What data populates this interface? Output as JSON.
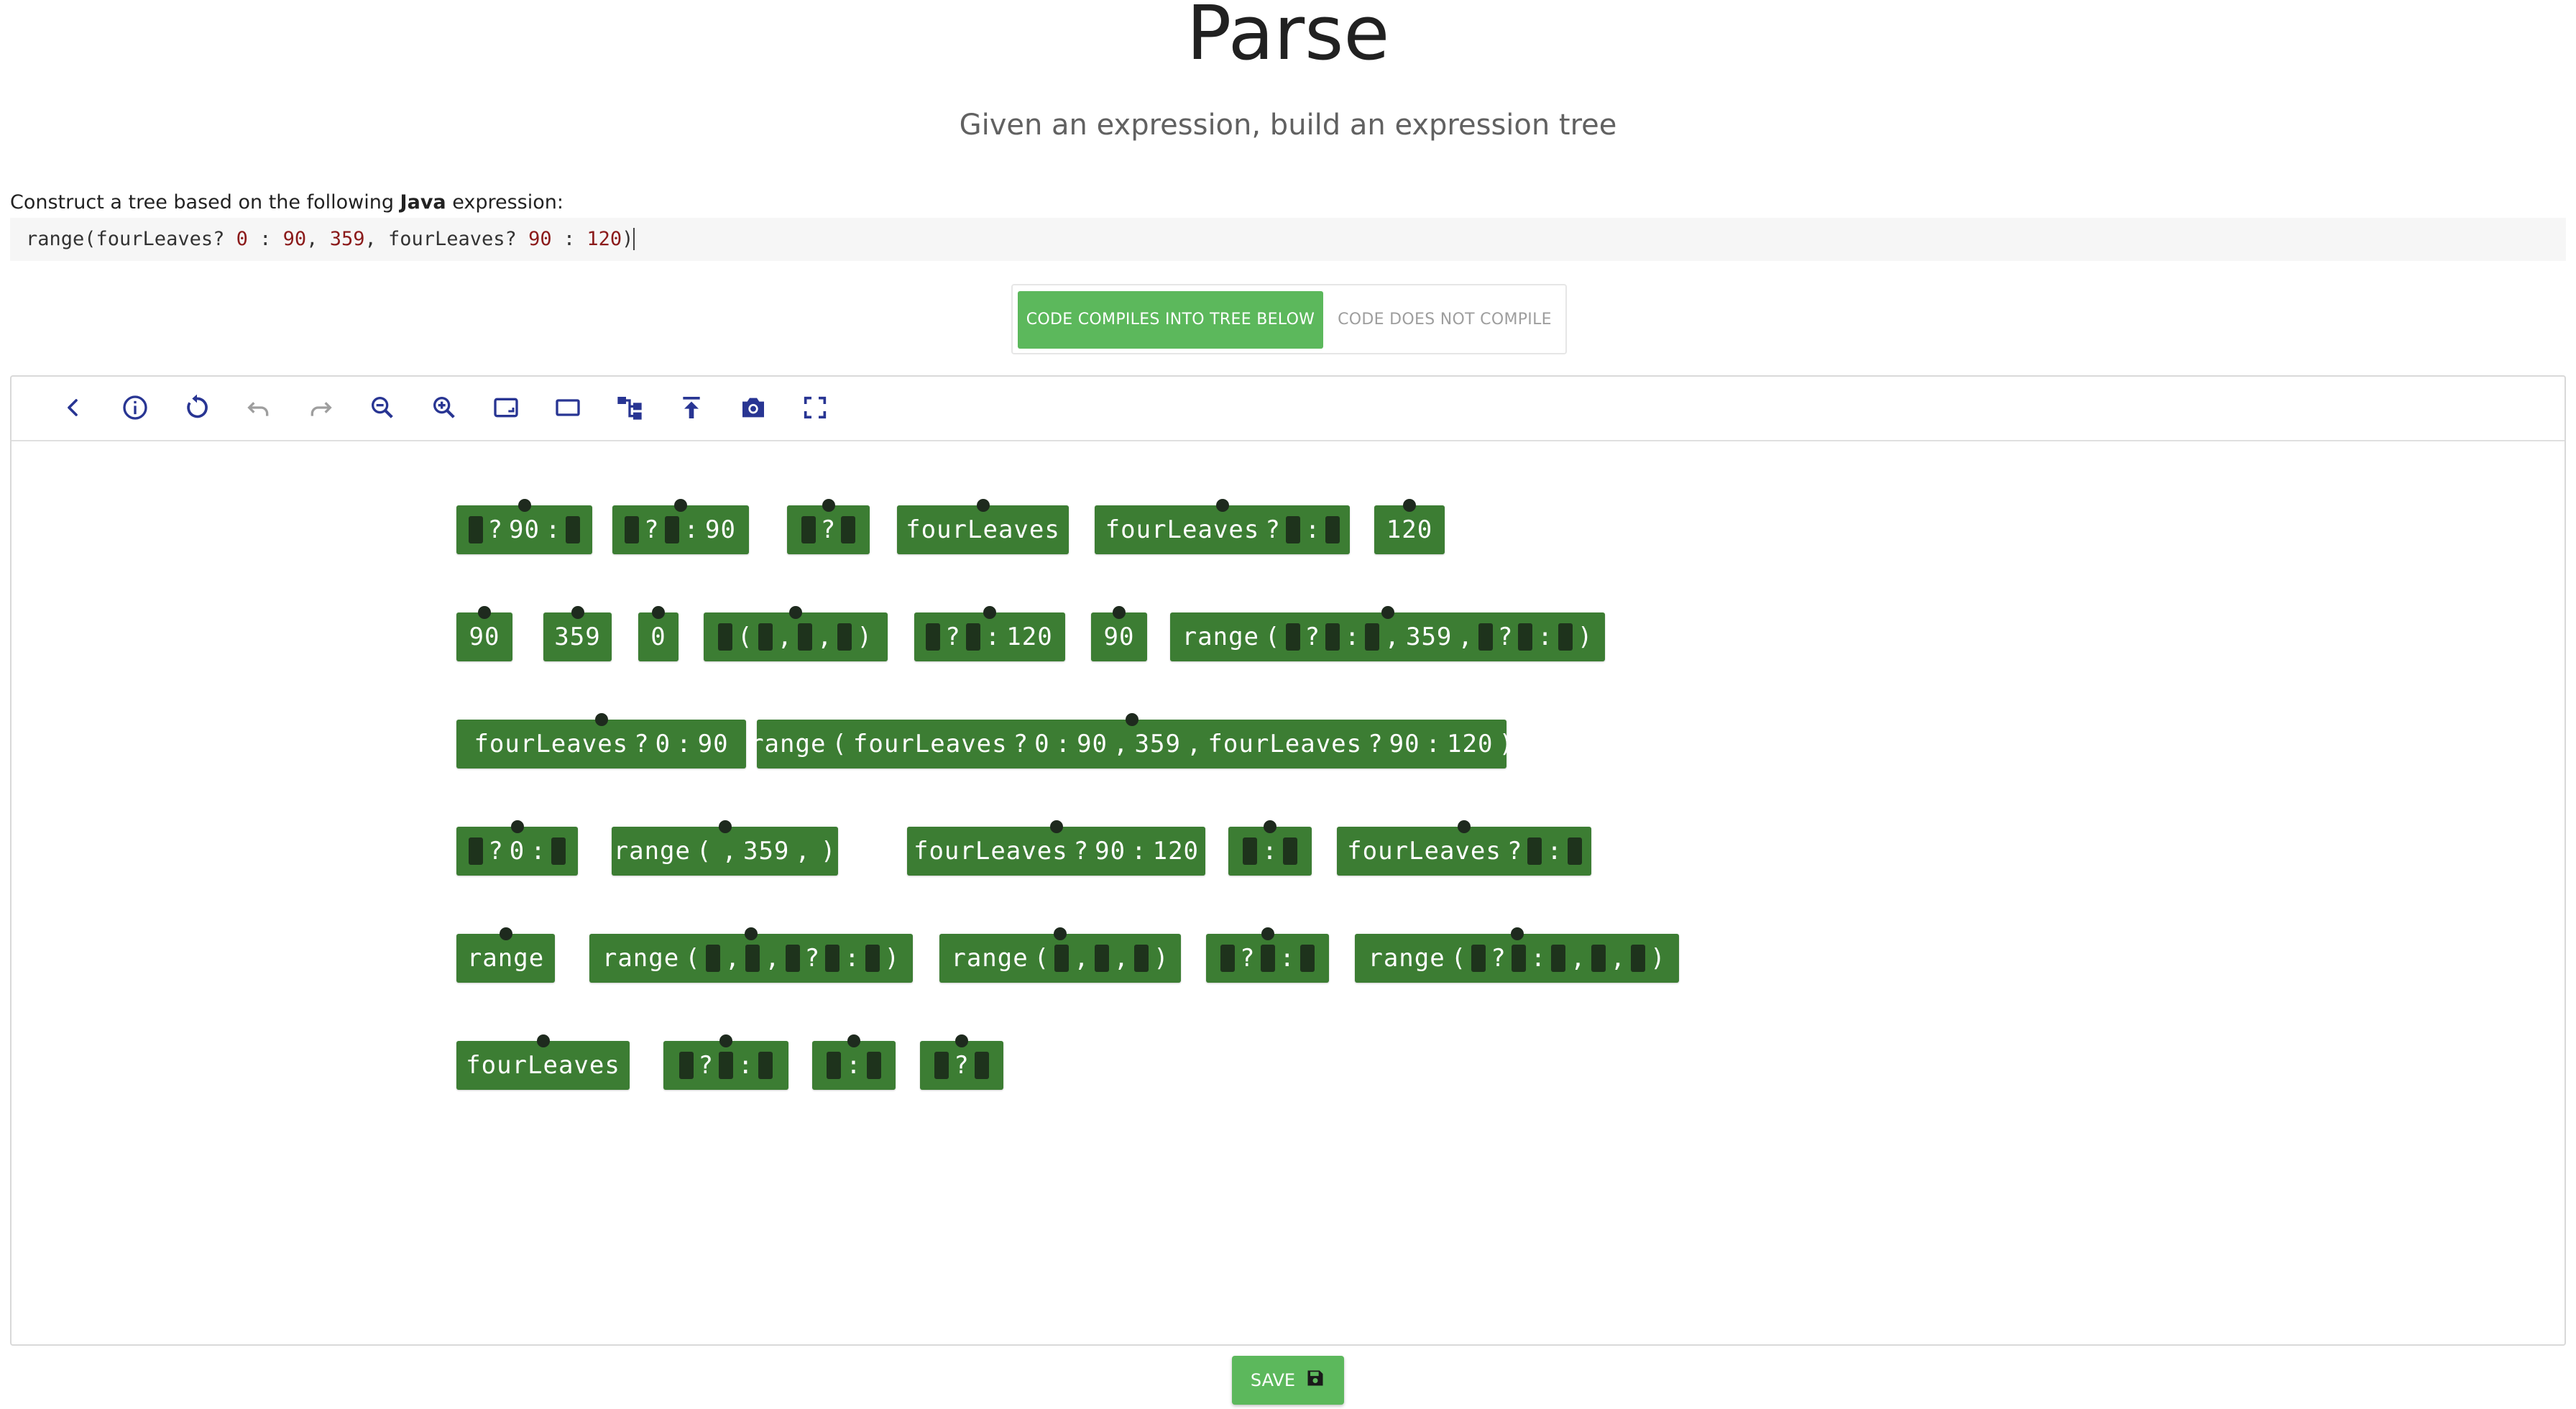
{
  "header": {
    "title": "Parse",
    "subtitle": "Given an expression, build an expression tree"
  },
  "instruction": {
    "prefix": "Construct a tree based on the following ",
    "language": "Java",
    "suffix": " expression:"
  },
  "code": {
    "parts": [
      {
        "t": "range(fourLeaves",
        "c": "op"
      },
      {
        "t": "?",
        "c": "op"
      },
      {
        "t": " 0",
        "c": "num"
      },
      {
        "t": " : ",
        "c": "op"
      },
      {
        "t": "90",
        "c": "num"
      },
      {
        "t": ", ",
        "c": "op"
      },
      {
        "t": "359",
        "c": "num"
      },
      {
        "t": ", fourLeaves",
        "c": "op"
      },
      {
        "t": "?",
        "c": "op"
      },
      {
        "t": " 90",
        "c": "num"
      },
      {
        "t": " : ",
        "c": "op"
      },
      {
        "t": "120",
        "c": "num"
      },
      {
        "t": ")",
        "c": "op caret"
      }
    ]
  },
  "toggle": {
    "compiles_label": "CODE COMPILES INTO TREE BELOW",
    "not_compiles_label": "CODE DOES NOT COMPILE",
    "selected": "compiles"
  },
  "toolbar": {
    "icons": [
      "back-icon",
      "info-icon",
      "reset-icon",
      "undo-icon",
      "redo-icon",
      "zoom-out-icon",
      "zoom-in-icon",
      "fit-to-view-icon",
      "rectangle-icon",
      "tree-layout-icon",
      "upload-icon",
      "camera-icon",
      "fullscreen-icon"
    ]
  },
  "nodes": [
    {
      "row": 0,
      "tokens": [
        "#",
        "?",
        "90",
        ":",
        "#"
      ]
    },
    {
      "row": 0,
      "tokens": [
        "#",
        "?",
        "#",
        ":",
        "90"
      ]
    },
    {
      "row": 0,
      "tokens": [
        "#",
        "?",
        "#"
      ]
    },
    {
      "row": 0,
      "tokens": [
        "fourLeaves"
      ]
    },
    {
      "row": 0,
      "tokens": [
        "fourLeaves",
        "?",
        "#",
        ":",
        "#"
      ]
    },
    {
      "row": 0,
      "tokens": [
        "120"
      ]
    },
    {
      "row": 1,
      "tokens": [
        "90"
      ]
    },
    {
      "row": 1,
      "tokens": [
        "359"
      ]
    },
    {
      "row": 1,
      "tokens": [
        "0"
      ]
    },
    {
      "row": 1,
      "tokens": [
        "#",
        "(",
        "#",
        ",",
        "#",
        ",",
        "#",
        ")"
      ]
    },
    {
      "row": 1,
      "tokens": [
        "#",
        "?",
        "#",
        ":",
        "120"
      ]
    },
    {
      "row": 1,
      "tokens": [
        "90"
      ]
    },
    {
      "row": 1,
      "tokens": [
        "range",
        "(",
        "#",
        "?",
        "#",
        ":",
        "#",
        ",",
        "359",
        ",",
        "#",
        "?",
        "#",
        ":",
        "#",
        ")"
      ]
    },
    {
      "row": 2,
      "tokens": [
        "fourLeaves",
        "?",
        "0",
        ":",
        "90"
      ]
    },
    {
      "row": 2,
      "tokens": [
        "range",
        "(",
        "fourLeaves",
        "?",
        "0",
        ":",
        "90",
        ",",
        "359",
        ",",
        "fourLeaves",
        "?",
        "90",
        ":",
        "120",
        ")"
      ]
    },
    {
      "row": 3,
      "tokens": [
        "#",
        "?",
        "0",
        ":",
        "#"
      ]
    },
    {
      "row": 3,
      "tokens": [
        "range",
        "(",
        "#",
        ",",
        "359",
        ",",
        "#",
        ")"
      ]
    },
    {
      "row": 3,
      "tokens": [
        "fourLeaves",
        "?",
        "90",
        ":",
        "120"
      ]
    },
    {
      "row": 3,
      "tokens": [
        "#",
        ":",
        "#"
      ]
    },
    {
      "row": 3,
      "tokens": [
        "fourLeaves",
        "?",
        "#",
        ":",
        "#"
      ]
    },
    {
      "row": 4,
      "tokens": [
        "range"
      ]
    },
    {
      "row": 4,
      "tokens": [
        "range",
        "(",
        "#",
        ",",
        "#",
        ",",
        "#",
        "?",
        "#",
        ":",
        "#",
        ")"
      ]
    },
    {
      "row": 4,
      "tokens": [
        "range",
        "(",
        "#",
        ",",
        "#",
        ",",
        "#",
        ")"
      ]
    },
    {
      "row": 4,
      "tokens": [
        "#",
        "?",
        "#",
        ":",
        "#"
      ]
    },
    {
      "row": 4,
      "tokens": [
        "range",
        "(",
        "#",
        "?",
        "#",
        ":",
        "#",
        ",",
        "#",
        ",",
        "#",
        ")"
      ]
    },
    {
      "row": 5,
      "tokens": [
        "fourLeaves"
      ]
    },
    {
      "row": 5,
      "tokens": [
        "#",
        "?",
        "#",
        ":",
        "#"
      ]
    },
    {
      "row": 5,
      "tokens": [
        "#",
        ":",
        "#"
      ]
    },
    {
      "row": 5,
      "tokens": [
        "#",
        "?",
        "#"
      ]
    }
  ],
  "save": {
    "label": "SAVE",
    "icon": "floppy-disk-icon"
  }
}
